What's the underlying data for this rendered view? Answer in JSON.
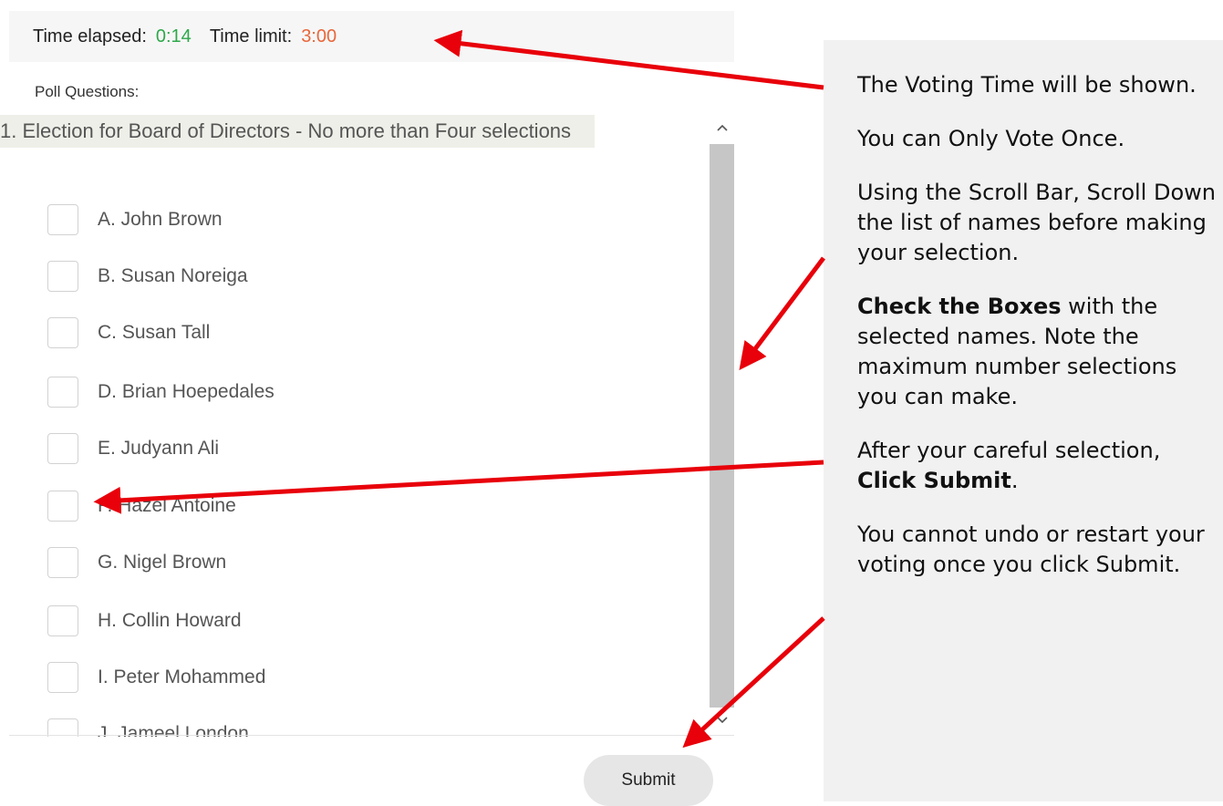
{
  "timer": {
    "elapsed_label": "Time elapsed:",
    "elapsed_value": "0:14",
    "limit_label": "Time limit:",
    "limit_value": "3:00"
  },
  "poll_label": "Poll Questions:",
  "question": "1.  Election for Board of Directors - No more than Four selections",
  "options": [
    "A.  John Brown",
    "B.  Susan Noreiga",
    "C.  Susan Tall",
    "D.  Brian Hoepedales",
    "E.  Judyann Ali",
    "F.  Hazel Antoine",
    "G.  Nigel Brown",
    "H.  Collin Howard",
    "I.  Peter Mohammed",
    "J.  Jameel London"
  ],
  "submit_label": "Submit",
  "help": {
    "p1": "The Voting Time will be shown.",
    "p2": "You can Only Vote Once.",
    "p3": "Using the Scroll Bar, Scroll Down the list of names before making your selection.",
    "p4_bold": "Check the Boxes",
    "p4_rest": " with the selected names. Note the maximum number selections you can make.",
    "p5_pre": "After your careful selection, ",
    "p5_bold": "Click Submit",
    "p5_post": ".",
    "p6": "You cannot undo or restart your voting once you click Submit."
  },
  "colors": {
    "elapsed": "#2ea84a",
    "limit": "#e8673a",
    "arrow": "#e8000a"
  },
  "icons": {
    "scroll_up": "chevron-up-icon",
    "scroll_down": "chevron-down-icon"
  }
}
